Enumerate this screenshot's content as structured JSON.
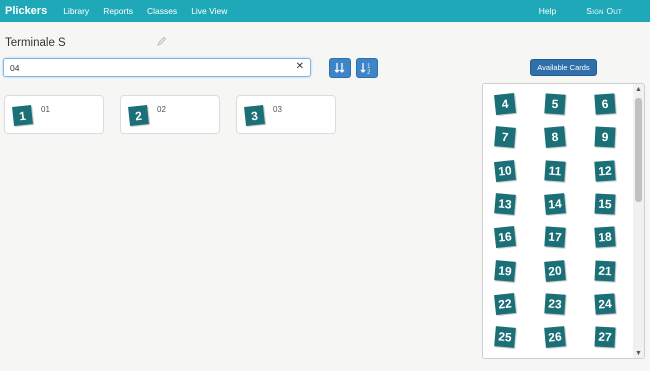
{
  "nav": {
    "brand": "Plickers",
    "links": [
      "Library",
      "Reports",
      "Classes",
      "Live View"
    ],
    "help": "Help",
    "signout": "Sign Out"
  },
  "section": {
    "title": "Terminale S"
  },
  "search": {
    "value": "04"
  },
  "results": [
    {
      "number": "1",
      "label": "01"
    },
    {
      "number": "2",
      "label": "02"
    },
    {
      "number": "3",
      "label": "03"
    }
  ],
  "available": {
    "button_label": "Available Cards",
    "cards": [
      "4",
      "5",
      "6",
      "7",
      "8",
      "9",
      "10",
      "11",
      "12",
      "13",
      "14",
      "15",
      "16",
      "17",
      "18",
      "19",
      "20",
      "21",
      "22",
      "23",
      "24",
      "25",
      "26",
      "27"
    ]
  },
  "colors": {
    "topbar": "#1fa9b8",
    "card": "#1b6f77",
    "button": "#3d84c8"
  }
}
